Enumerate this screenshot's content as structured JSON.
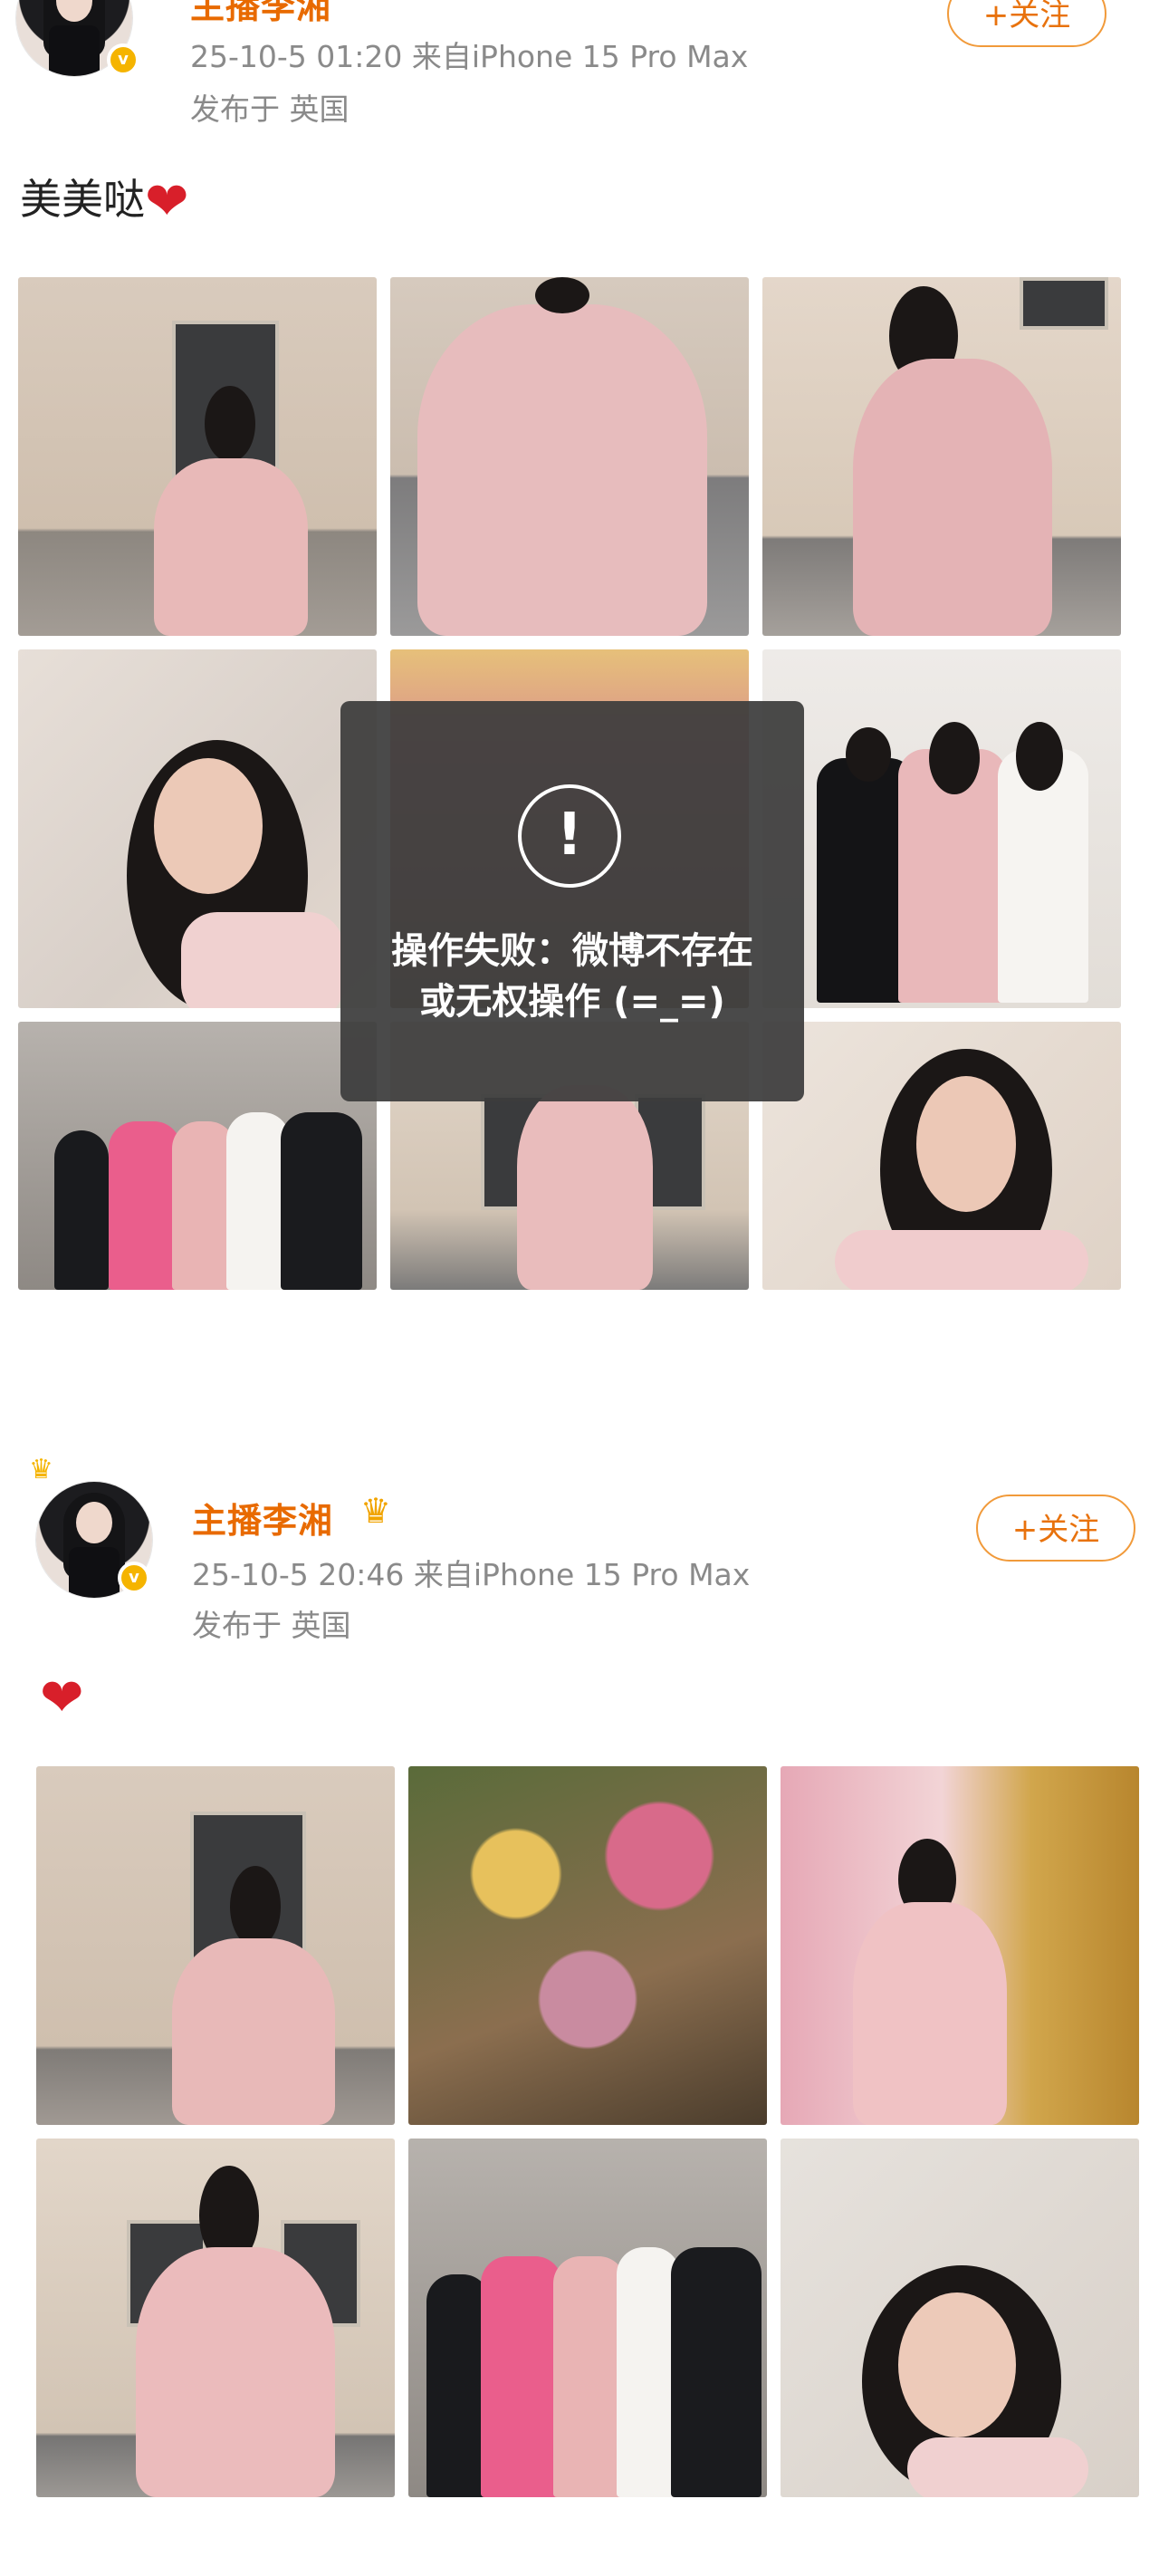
{
  "posts": [
    {
      "username": "主播李湘",
      "meta_line": "25-10-5 01:20  来自iPhone 15 Pro Max",
      "location": "发布于 英国",
      "follow_label": "+关注",
      "caption_text": "美美哒",
      "caption_emoji": "heart"
    },
    {
      "username": "主播李湘",
      "meta_line": "25-10-5 20:46  来自iPhone 15 Pro Max",
      "location": "发布于 英国",
      "follow_label": "+关注",
      "caption_text": "",
      "caption_emoji": "heart"
    }
  ],
  "toast": {
    "icon": "!",
    "message": "操作失败：微博不存在或无权操作 (=_=)"
  },
  "colors": {
    "username": "#e86a00",
    "follow_border": "#f19a3a",
    "meta": "#8a8a8a",
    "heart": "#d81f2a",
    "verified_badge": "#f5b400"
  },
  "icons": {
    "verified": "verified-badge-icon",
    "crown": "crown-icon",
    "heart": "heart-icon",
    "alert": "exclamation-circle-icon"
  }
}
